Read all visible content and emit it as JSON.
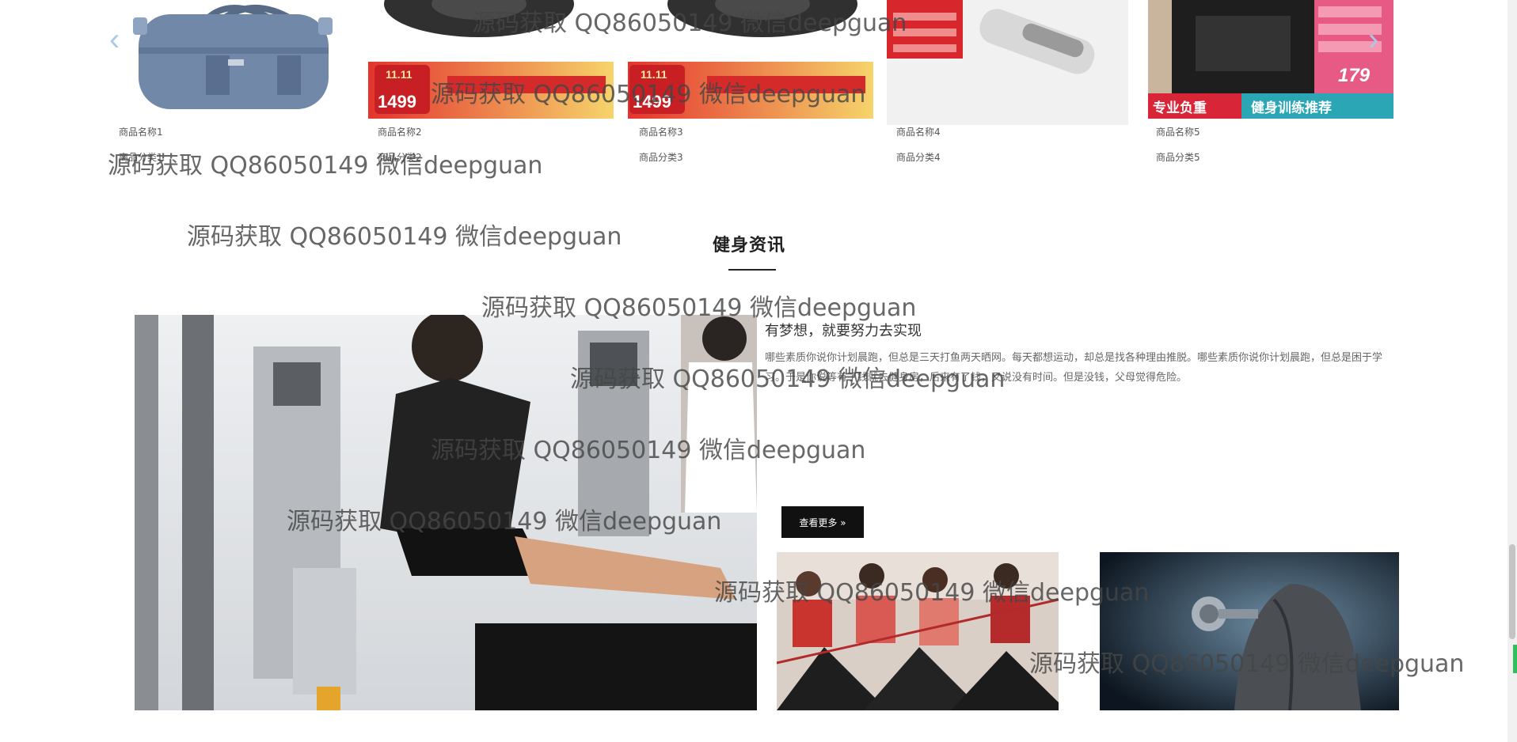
{
  "products": [
    {
      "name": "商品名称1",
      "category": "商品分类1",
      "badge": "",
      "price": ""
    },
    {
      "name": "商品名称2",
      "category": "商品分类2",
      "badge": "11.11",
      "price": "1499"
    },
    {
      "name": "商品名称3",
      "category": "商品分类3",
      "badge": "11.11",
      "price": "1499"
    },
    {
      "name": "商品名称4",
      "category": "商品分类4",
      "badge": "",
      "price": ""
    },
    {
      "name": "商品名称5",
      "category": "商品分类5",
      "badge": "专业负重",
      "price": "179"
    }
  ],
  "product5_banner": "健身训练推荐",
  "carousel": {
    "prev_icon": "chevron-left-icon",
    "next_icon": "chevron-right-icon"
  },
  "section": {
    "title": "健身资讯"
  },
  "news": {
    "title": "有梦想，就要努力去实现",
    "body": "哪些素质你说你计划晨跑，但总是三天打鱼两天晒网。每天都想运动，却总是找各种理由推脱。哪些素质你说你计划晨跑，但总是困于学习。于是你说等有了钱就去健身房，后来有了钱，又说没有时间。但是没钱，父母觉得危险。",
    "read_more": "查看更多 »"
  },
  "watermark": "源码获取 QQ86050149 微信deepguan",
  "colors": {
    "accent_dark": "#111111",
    "badge_red": "#d9252a",
    "badge_yellow": "#f7d15a"
  }
}
